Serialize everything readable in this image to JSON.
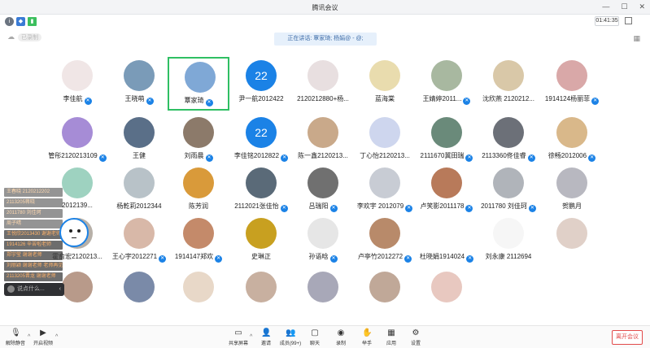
{
  "window": {
    "title": "腾讯会议",
    "timer": "01:41:35"
  },
  "speaking": "正在讲话: 覃家琦; 杨娟@ - @;",
  "cloud": {
    "label": "已录制"
  },
  "participants": [
    {
      "name": "李佳航",
      "color": "#f0e6e6",
      "badge": true
    },
    {
      "name": "王晓萌",
      "color": "#7a9bb8",
      "badge": true
    },
    {
      "name": "覃家琦",
      "color": "#7fa8d6",
      "badge": true,
      "active": true
    },
    {
      "name": "尹一航2012422",
      "number": "22",
      "badge": false
    },
    {
      "name": "2120212880+杨...",
      "color": "#e8dfe0",
      "badge": false
    },
    {
      "name": "蓝海棠",
      "color": "#e9dcae",
      "badge": false
    },
    {
      "name": "王婧婷2011...",
      "color": "#a8b8a0",
      "badge": true
    },
    {
      "name": "沈欣燕 2120212...",
      "color": "#d9c8a8",
      "badge": false
    },
    {
      "name": "1914124杨丽菲",
      "color": "#d9a8a8",
      "badge": true
    },
    {
      "name": "管彤2120213109",
      "color": "#a68cd6",
      "badge": true
    },
    {
      "name": "王健",
      "color": "#5a6f88",
      "badge": false
    },
    {
      "name": "刘雨晨",
      "color": "#8c7a6a",
      "badge": true
    },
    {
      "name": "李佳铭2012822",
      "number": "22",
      "badge": true
    },
    {
      "name": "陈一鑫2120213...",
      "color": "#c9a98a",
      "badge": false
    },
    {
      "name": "丁心怡2120213...",
      "color": "#ced6ee",
      "badge": false
    },
    {
      "name": "2111670冀田瑞",
      "color": "#6a8a7a",
      "badge": true
    },
    {
      "name": "2113360佟佳睿",
      "color": "#6c7078",
      "badge": true
    },
    {
      "name": "徐畅2012006",
      "color": "#d9b88a",
      "badge": true
    },
    {
      "name": "2012139...",
      "color": "#9ed2c0",
      "badge": false
    },
    {
      "name": "杨乾莉2012344",
      "color": "#b8c2c8",
      "badge": false
    },
    {
      "name": "陈芳润",
      "color": "#d99a3a",
      "badge": false
    },
    {
      "name": "2112021张佳怡",
      "color": "#5a6a78",
      "badge": true
    },
    {
      "name": "吕瑞阳",
      "color": "#707070",
      "badge": true
    },
    {
      "name": "李欢宇 2012079",
      "color": "#c8ccd4",
      "badge": true
    },
    {
      "name": "卢笑影2011178",
      "color": "#b87a5a",
      "badge": true
    },
    {
      "name": "2011780 刘佳珂",
      "color": "#b0b4ba",
      "badge": true
    },
    {
      "name": "贺鹏月",
      "color": "#b8b8c0",
      "badge": false
    },
    {
      "name": "霍俞宏2120213...",
      "color": "#b7b0a8",
      "badge": false
    },
    {
      "name": "王心宇2012271",
      "color": "#d8b8a8",
      "badge": true
    },
    {
      "name": "1914147郑欢",
      "color": "#c48a6a",
      "badge": true
    },
    {
      "name": "史琳正",
      "color": "#c8a020",
      "badge": false
    },
    {
      "name": "孙语晗",
      "color": "#e6e6e6",
      "badge": true
    },
    {
      "name": "卢亭竹2012272",
      "color": "#b88a6a",
      "badge": true
    },
    {
      "name": "杜晓娟1914024",
      "color": "#ffffff",
      "badge": true
    },
    {
      "name": "刘永康 2112694",
      "color": "#f6f6f6",
      "badge": false
    },
    {
      "name": "",
      "color": "#e0d0c8",
      "badge": false
    },
    {
      "name": "",
      "color": "#b89a8a",
      "badge": false
    },
    {
      "name": "",
      "color": "#7a8aa8",
      "badge": false
    },
    {
      "name": "",
      "color": "#e8d8c8",
      "badge": false
    },
    {
      "name": "",
      "color": "#c8b0a0",
      "badge": false
    },
    {
      "name": "",
      "color": "#a8a8b8",
      "badge": false
    },
    {
      "name": "",
      "color": "#c0a898",
      "badge": false
    },
    {
      "name": "",
      "color": "#e8c8c0",
      "badge": false
    }
  ],
  "chat": {
    "messages": [
      "王春晓 2120212202",
      "2113205蒋晓",
      "2011780 刘佳珂",
      "周子晴",
      "王悦欣2013430  谢谢老师",
      "1914126  辛苦啦老师",
      "郑宇莹  谢谢老师",
      "刘丽颖  谢谢老师 老师再见!",
      "2113205晋龙  谢谢老师"
    ],
    "input_placeholder": "说点什么..."
  },
  "toolbar": {
    "mute": "解除静音",
    "video": "开启视频",
    "share": "共享屏幕",
    "invite": "邀请",
    "members": "成员(99+)",
    "chat": "聊天",
    "record": "录制",
    "react": "举手",
    "apps": "应用",
    "settings": "设置",
    "end": "离开会议"
  }
}
